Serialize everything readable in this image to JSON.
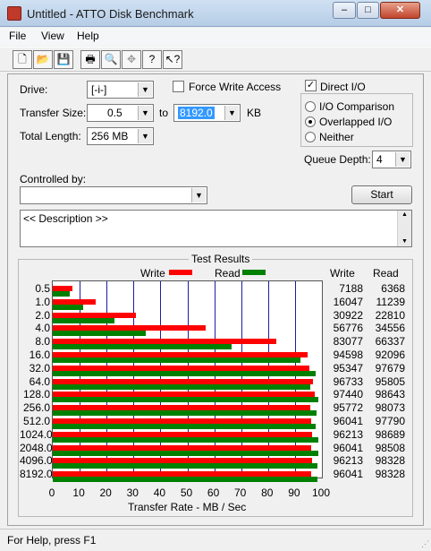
{
  "window": {
    "title": "Untitled - ATTO Disk Benchmark",
    "minimize": "–",
    "maximize": "□",
    "close": "✕"
  },
  "menu": {
    "file": "File",
    "view": "View",
    "help": "Help"
  },
  "toolbar": {
    "icons": [
      "new-file-icon",
      "open-folder-icon",
      "save-icon",
      "print-icon",
      "print-preview-icon",
      "move-icon",
      "help-icon",
      "context-help-icon"
    ]
  },
  "form": {
    "drive_label": "Drive:",
    "drive_value": "[-i-]",
    "transfer_size_label": "Transfer Size:",
    "transfer_from": "0.5",
    "to_label": "to",
    "transfer_to": "8192.0",
    "unit": "KB",
    "total_length_label": "Total Length:",
    "total_length_value": "256 MB",
    "force_write_label": "Force Write Access",
    "force_write_checked": false,
    "direct_io_label": "Direct I/O",
    "direct_io_checked": true,
    "io_comparison_label": "I/O Comparison",
    "overlapped_io_label": "Overlapped I/O",
    "neither_label": "Neither",
    "io_mode_selected": "Overlapped I/O",
    "queue_depth_label": "Queue Depth:",
    "queue_depth_value": "4",
    "controlled_by_label": "Controlled by:",
    "controlled_by_value": "",
    "start_label": "Start",
    "description": "<< Description >>"
  },
  "results": {
    "group_label": "Test Results",
    "write_legend": "Write",
    "read_legend": "Read",
    "write_col": "Write",
    "read_col": "Read",
    "write_color": "#ff0000",
    "read_color": "#008000"
  },
  "chart_data": {
    "type": "bar",
    "orientation": "horizontal",
    "categories": [
      "0.5",
      "1.0",
      "2.0",
      "4.0",
      "8.0",
      "16.0",
      "32.0",
      "64.0",
      "128.0",
      "256.0",
      "512.0",
      "1024.0",
      "2048.0",
      "4096.0",
      "8192.0"
    ],
    "series": [
      {
        "name": "Write",
        "values": [
          7188,
          16047,
          30922,
          56776,
          83077,
          94598,
          95347,
          96733,
          97440,
          95772,
          96041,
          96213,
          96041,
          96213,
          96041
        ]
      },
      {
        "name": "Read",
        "values": [
          6368,
          11239,
          22810,
          34556,
          66337,
          92096,
          97679,
          95805,
          98643,
          98073,
          97790,
          98689,
          98508,
          98328,
          98328
        ]
      }
    ],
    "xlabel": "Transfer Rate - MB / Sec",
    "ylabel": "",
    "xlim": [
      0,
      100
    ],
    "xticks": [
      0,
      10,
      20,
      30,
      40,
      50,
      60,
      70,
      80,
      90,
      100
    ],
    "grid": true,
    "legend": "top-center"
  },
  "status": {
    "text": "For Help, press F1"
  }
}
